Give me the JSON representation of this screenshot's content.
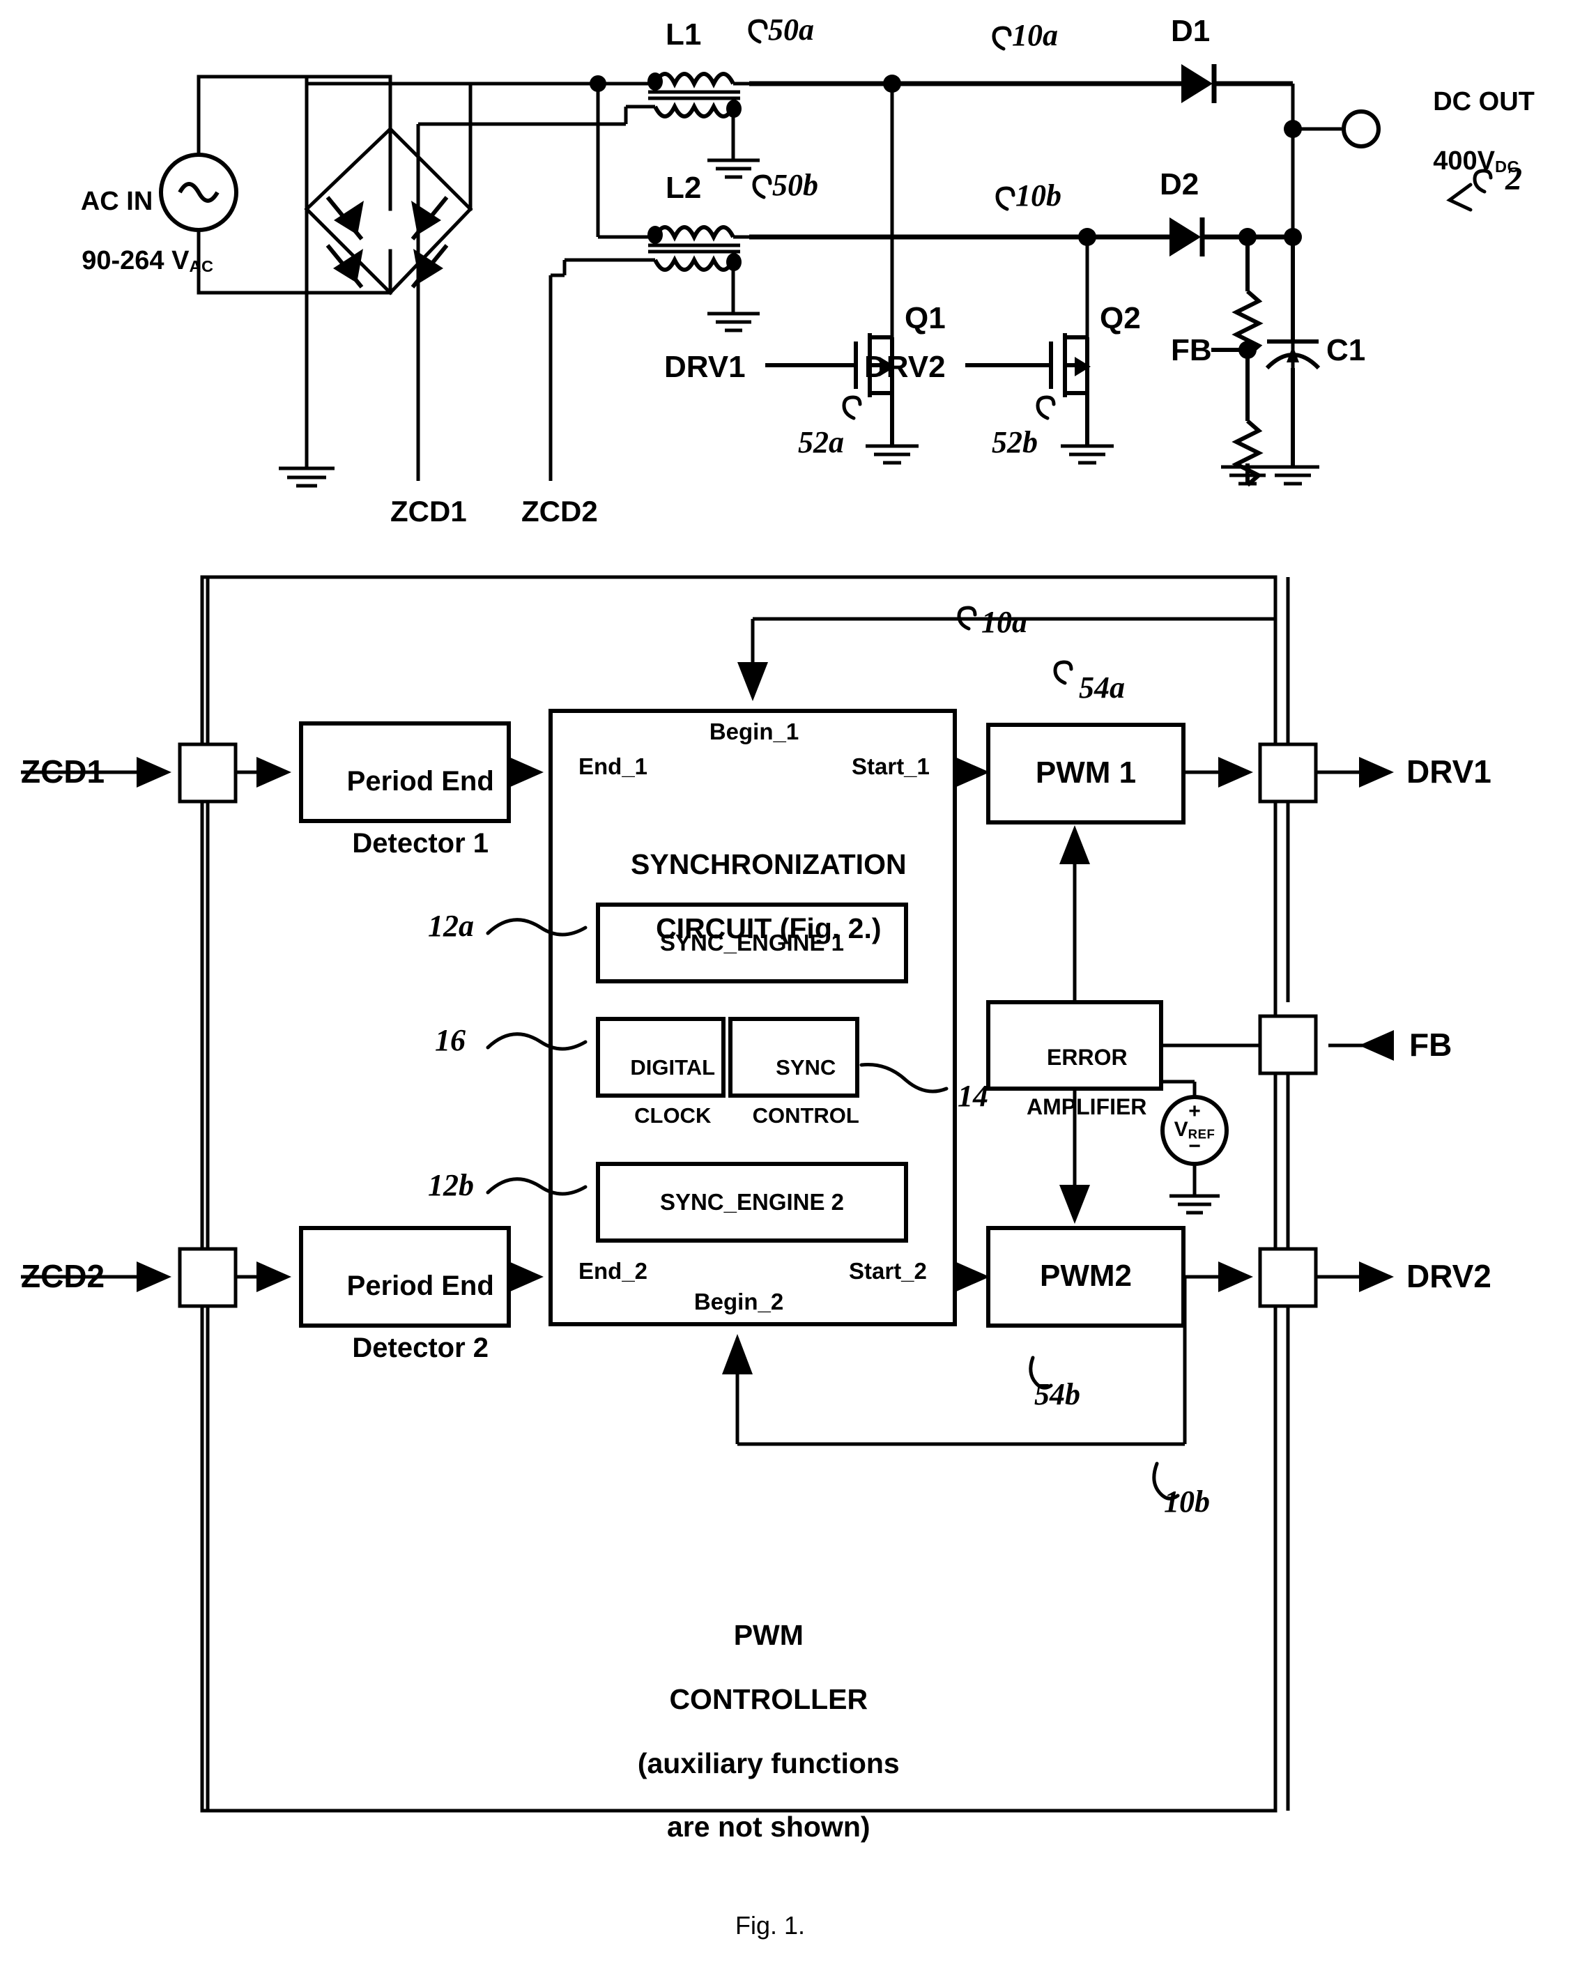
{
  "figure": {
    "caption": "Fig. 1.",
    "top_ref": "2"
  },
  "power_stage": {
    "ac_in_line1": "AC IN",
    "ac_in_line2_prefix": "90-264 V",
    "ac_in_line2_sub": "AC",
    "inductor1": "L1",
    "inductor2": "L2",
    "inductor1_ref": "50a",
    "inductor2_ref": "50b",
    "branch1_ref": "10a",
    "branch2_ref": "10b",
    "diode1": "D1",
    "diode2": "D2",
    "mosfet1": "Q1",
    "mosfet2": "Q2",
    "mosfet1_ref": "52a",
    "mosfet2_ref": "52b",
    "drive1": "DRV1",
    "drive2": "DRV2",
    "feedback": "FB",
    "capacitor": "C1",
    "dc_out_line1": "DC OUT",
    "dc_out_line2_prefix": "400V",
    "dc_out_line2_sub": "DC",
    "zcd1": "ZCD1",
    "zcd2": "ZCD2"
  },
  "controller": {
    "title_line1": "PWM",
    "title_line2": "CONTROLLER",
    "title_line3": "(auxiliary functions",
    "title_line4": "are not shown)",
    "pin_zcd1": "ZCD1",
    "pin_zcd2": "ZCD2",
    "pin_drv1": "DRV1",
    "pin_drv2": "DRV2",
    "pin_fb": "FB",
    "period_end_detector_1_line1": "Period End",
    "period_end_detector_1_line2": "Detector 1",
    "period_end_detector_2_line1": "Period End",
    "period_end_detector_2_line2": "Detector 2",
    "sync_title_line1": "SYNCHRONIZATION",
    "sync_title_line2": "CIRCUIT (Fig. 2.)",
    "sync_engine_1": "SYNC_ENGINE 1",
    "sync_engine_2": "SYNC_ENGINE 2",
    "digital_clock_line1": "DIGITAL",
    "digital_clock_line2": "CLOCK",
    "sync_control_line1": "SYNC",
    "sync_control_line2": "CONTROL",
    "port_end_1": "End_1",
    "port_begin_1": "Begin_1",
    "port_start_1": "Start_1",
    "port_end_2": "End_2",
    "port_begin_2": "Begin_2",
    "port_start_2": "Start_2",
    "pwm1": "PWM 1",
    "pwm2": "PWM2",
    "error_amp_line1": "ERROR",
    "error_amp_line2": "AMPLIFIER",
    "vref_prefix": "V",
    "vref_sub": "REF",
    "vref_plus": "+",
    "vref_minus": "−",
    "ref_sync_engine_1": "12a",
    "ref_digital_clock": "16",
    "ref_sync_engine_2": "12b",
    "ref_sync_control": "14",
    "ref_pwm1": "54a",
    "ref_pwm2": "54b",
    "ref_feedback_10a": "10a",
    "ref_feedback_10b": "10b"
  }
}
